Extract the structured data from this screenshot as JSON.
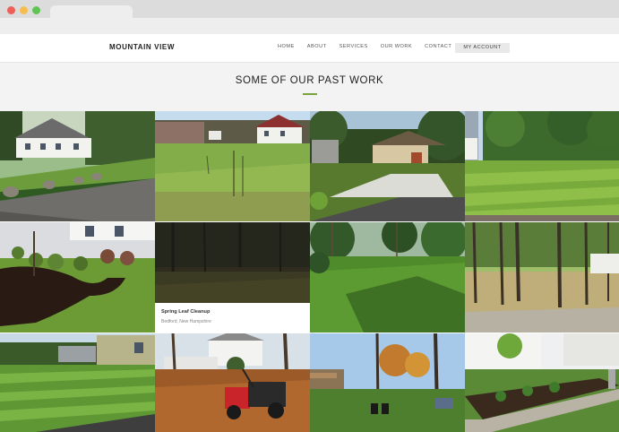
{
  "brand": {
    "name": "MOUNTAIN VIEW"
  },
  "nav": {
    "items": [
      "HOME",
      "ABOUT",
      "SERVICES",
      "OUR WORK",
      "CONTACT"
    ],
    "account": "MY ACCOUNT"
  },
  "hero": {
    "title": "SOME OF OUR PAST WORK"
  },
  "gallery": {
    "caption": {
      "title": "Spring Leaf Cleanup",
      "location": "Bedford, New Hampshire"
    }
  },
  "colors": {
    "accent": "#79a33a",
    "page_bg": "#f3f3f3"
  }
}
